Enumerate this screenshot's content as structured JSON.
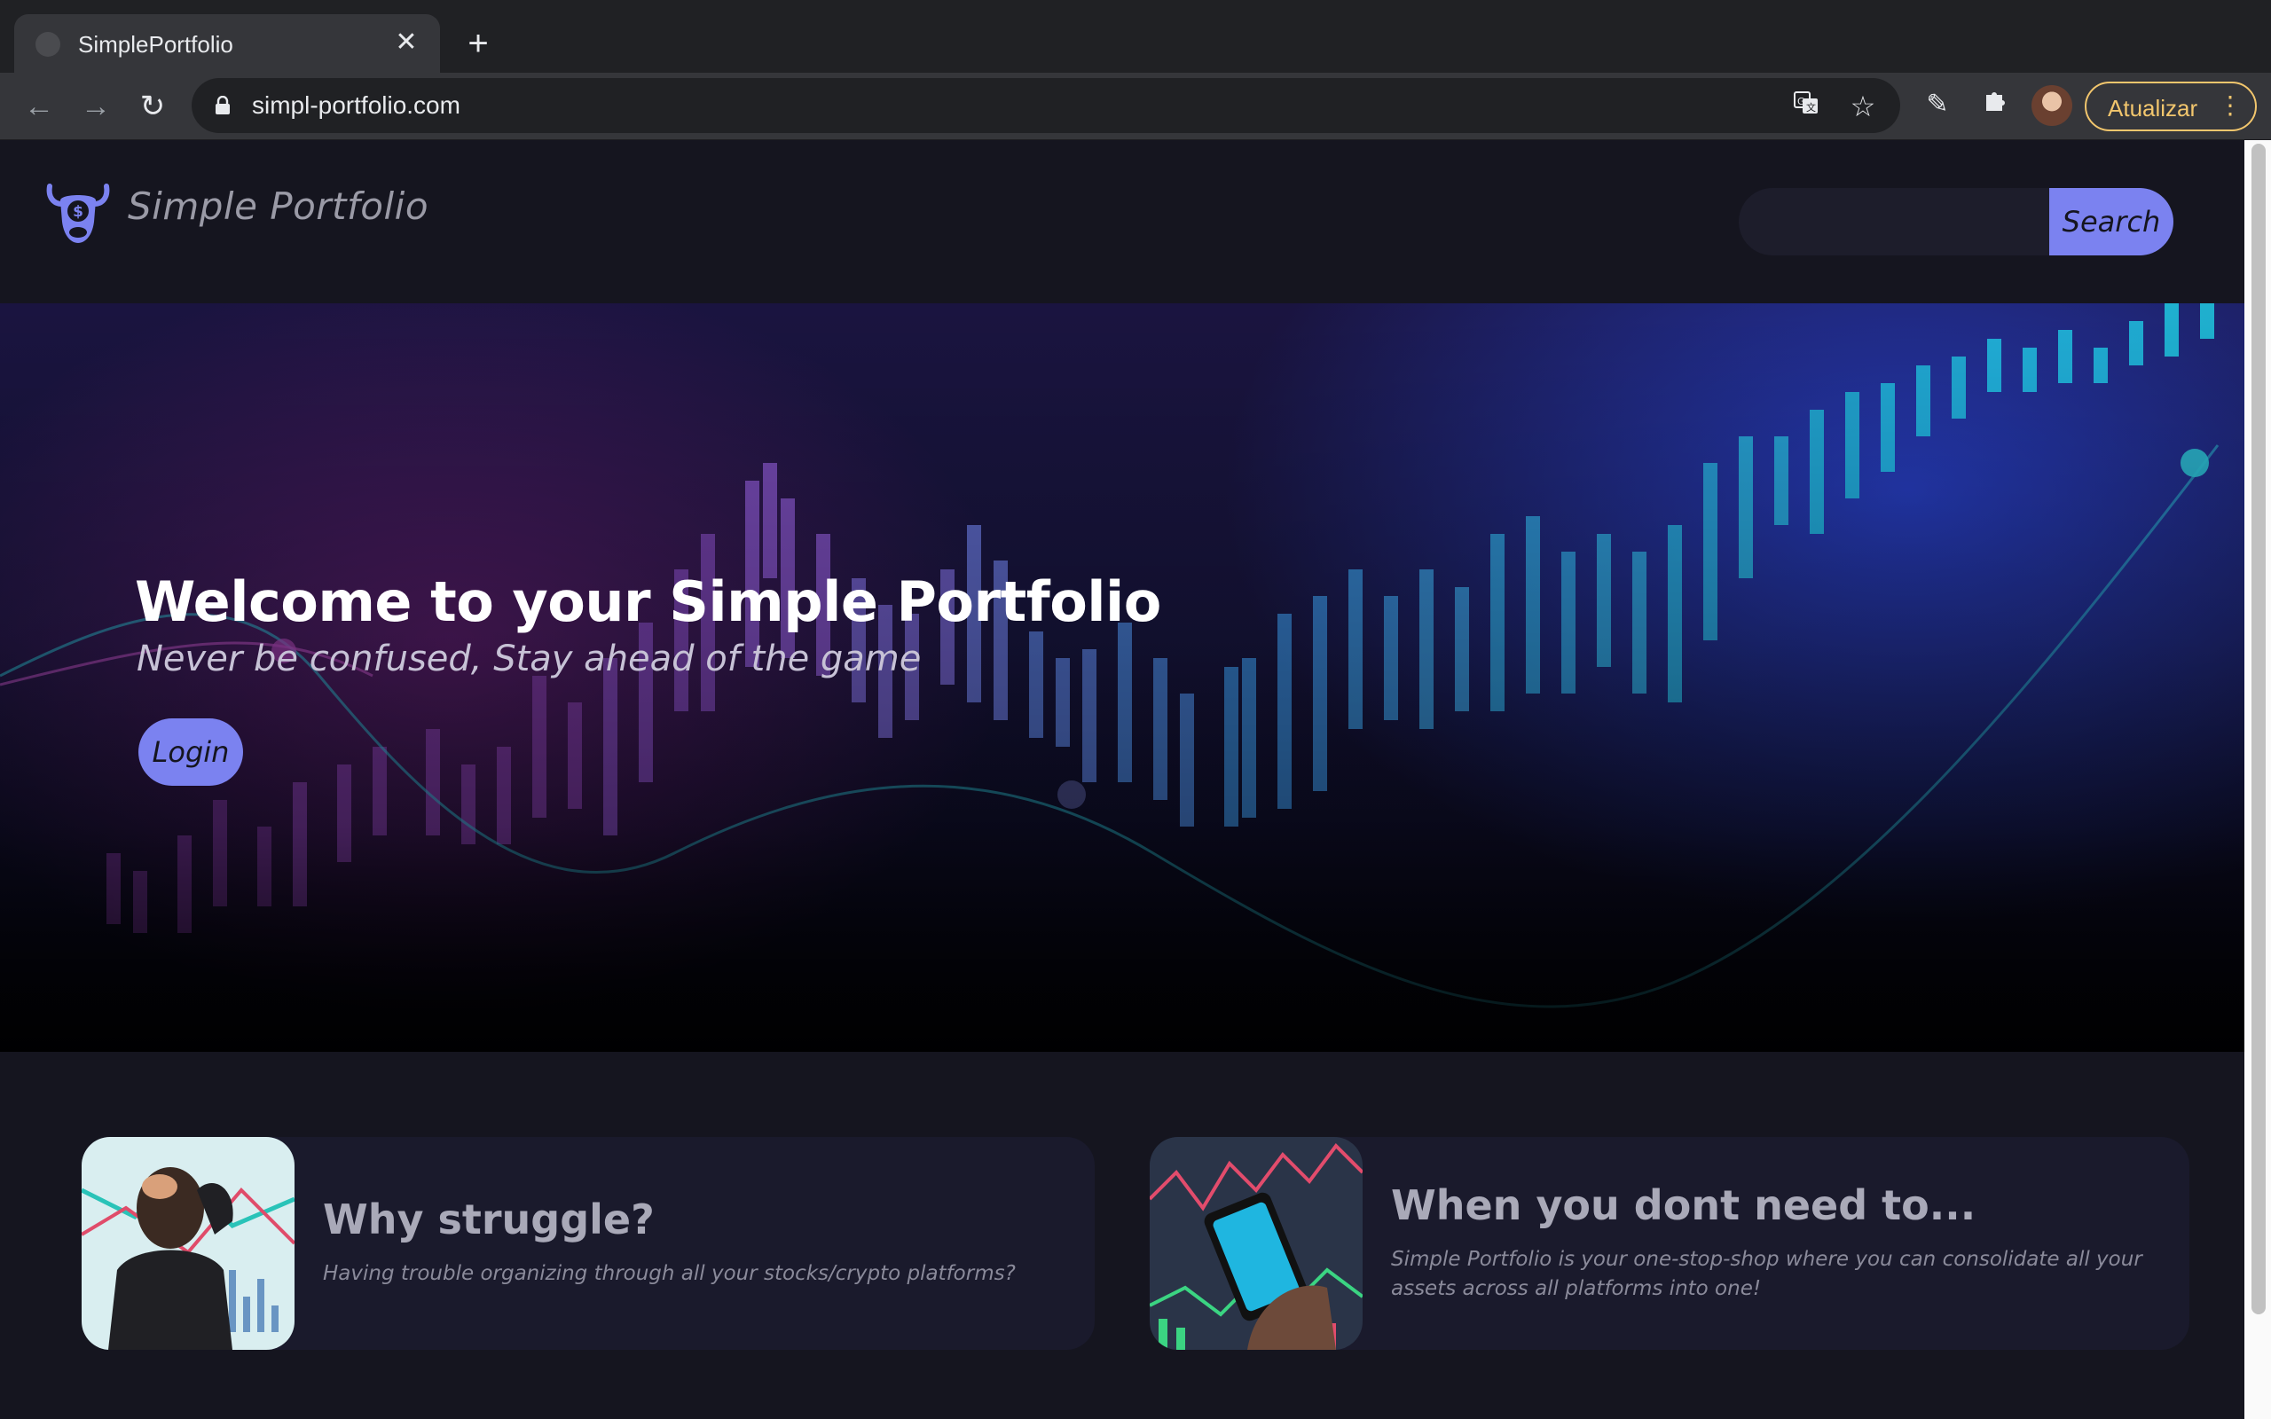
{
  "browser": {
    "tab_title": "SimplePortfolio",
    "url": "simpl-portfolio.com",
    "update_label": "Atualizar",
    "icons": [
      "favicon-icon",
      "close-icon",
      "plus-icon",
      "back-icon",
      "forward-icon",
      "reload-icon",
      "lock-icon",
      "translate-icon",
      "star-icon",
      "pen-icon",
      "puzzle-icon",
      "avatar",
      "menu-dots-icon"
    ]
  },
  "header": {
    "logo_text": "Simple Portfolio",
    "logo_icon": "bull-dollar-icon",
    "search_placeholder": "",
    "search_label": "Search"
  },
  "hero": {
    "title": "Welcome to your Simple Portfolio",
    "subtitle": "Never be confused, Stay ahead of the game",
    "login_label": "Login"
  },
  "cards": [
    {
      "title": "Why struggle?",
      "text": "Having trouble organizing through all your stocks/crypto platforms?",
      "image": "stressed-trader-image"
    },
    {
      "title": "When you dont need to...",
      "text": "Simple Portfolio is your one-stop-shop where you can consolidate all your assets across all platforms into one!",
      "image": "phone-trading-image"
    }
  ],
  "colors": {
    "accent": "#7b82f0",
    "background": "#15151f",
    "update_outline": "#f2c66d"
  }
}
